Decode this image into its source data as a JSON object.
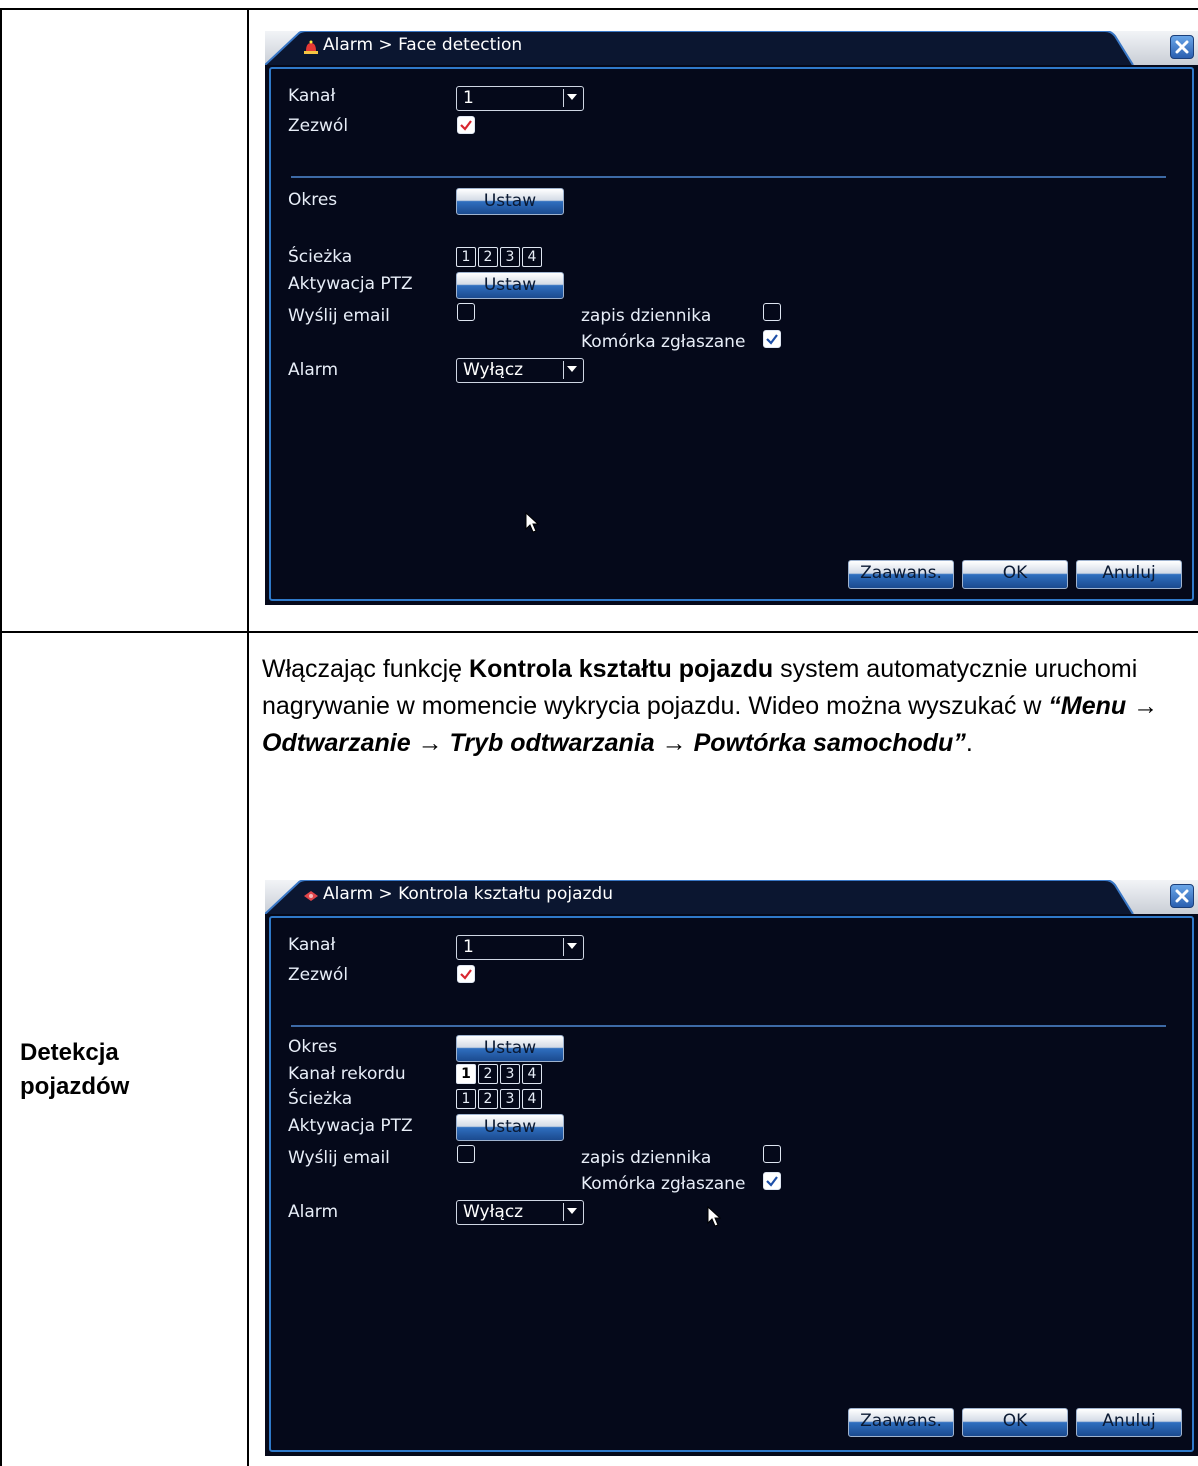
{
  "window1": {
    "title": "Alarm > Face detection",
    "fields": {
      "kanal_label": "Kanał",
      "kanal_value": "1",
      "zezwol_label": "Zezwól",
      "okres_label": "Okres",
      "okres_button": "Ustaw",
      "sciezka_label": "Ścieżka",
      "ptz_label": "Aktywacja PTZ",
      "ptz_button": "Ustaw",
      "email_label": "Wyślij email",
      "log_label": "zapis dziennika",
      "mobile_label": "Komórka zgłaszane",
      "alarm_label": "Alarm",
      "alarm_value": "Wyłącz"
    },
    "channels": [
      "1",
      "2",
      "3",
      "4"
    ],
    "footer": {
      "advanced": "Zaawans.",
      "ok": "OK",
      "cancel": "Anuluj"
    }
  },
  "section2": {
    "label": "Detekcja pojazdów",
    "description": {
      "t1": "Włączając funkcję ",
      "b1": "Kontrola kształtu pojazdu",
      "t2": " system automatycznie uruchomi nagrywanie w momencie wykrycia pojazdu. Wideo można wyszukać w ",
      "bi1": "“Menu → Odtwarzanie → Tryb odtwarzania → Powtórka samochodu”",
      "t3": "."
    }
  },
  "window2": {
    "title": "Alarm > Kontrola kształtu pojazdu",
    "fields": {
      "kanal_label": "Kanał",
      "kanal_value": "1",
      "zezwol_label": "Zezwól",
      "okres_label": "Okres",
      "okres_button": "Ustaw",
      "record_label": "Kanał rekordu",
      "sciezka_label": "Ścieżka",
      "ptz_label": "Aktywacja PTZ",
      "ptz_button": "Ustaw",
      "email_label": "Wyślij email",
      "log_label": "zapis dziennika",
      "mobile_label": "Komórka zgłaszane",
      "alarm_label": "Alarm",
      "alarm_value": "Wyłącz"
    },
    "record_channels": [
      "1",
      "2",
      "3",
      "4"
    ],
    "channels": [
      "1",
      "2",
      "3",
      "4"
    ],
    "footer": {
      "advanced": "Zaawans.",
      "ok": "OK",
      "cancel": "Anuluj"
    }
  },
  "icons": {
    "title_icon_1": "alarm-siren-icon",
    "title_icon_2": "alarm-siren-icon",
    "close": "close-icon",
    "dropdown": "chevron-down-icon",
    "checkmark": "checkmark-icon",
    "cursor": "mouse-pointer-icon"
  },
  "colors": {
    "dvr_background": "#05091a",
    "dvr_border": "#2f79c9",
    "separator": "#3d6aa6",
    "check_red": "#d8262f"
  }
}
